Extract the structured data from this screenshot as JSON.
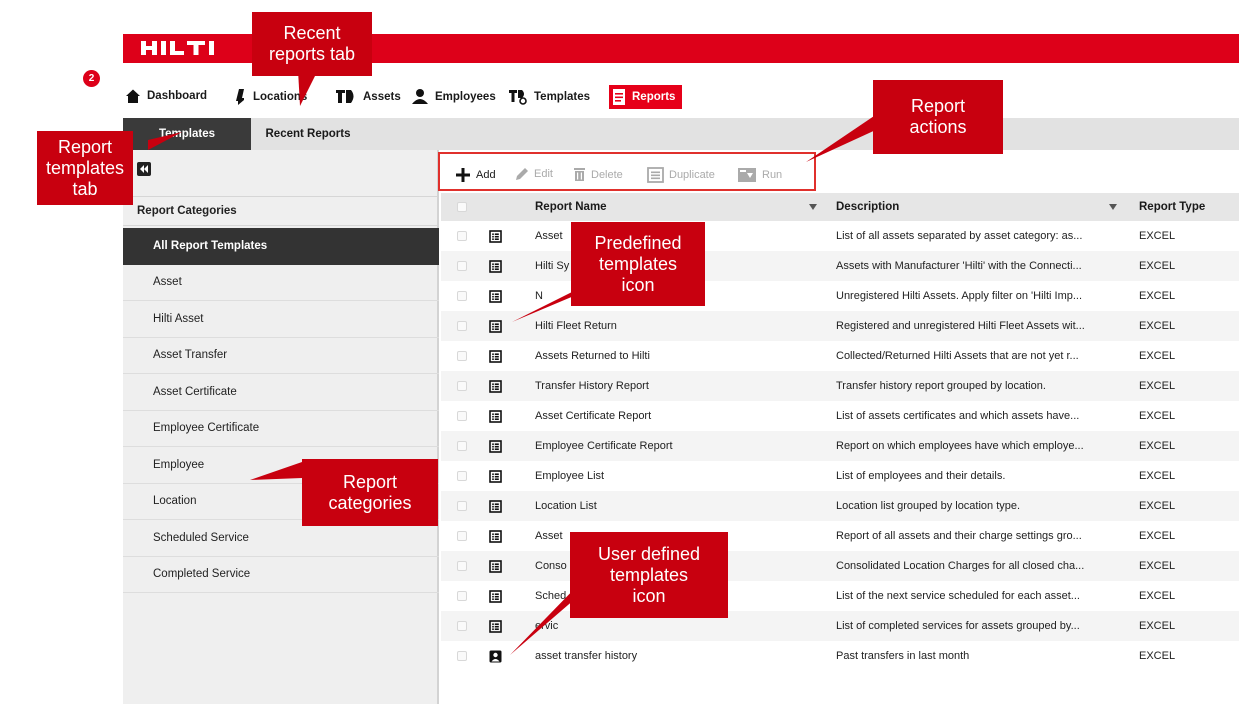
{
  "brand": {
    "logo_text": "HILTI",
    "accent": "#dd0019"
  },
  "nav": {
    "badge": "2",
    "items": [
      {
        "label": "Dashboard",
        "icon": "home-icon"
      },
      {
        "label": "Locations",
        "icon": "location-pin-icon"
      },
      {
        "label": "Assets",
        "icon": "assets-icon"
      },
      {
        "label": "Employees",
        "icon": "employees-icon"
      },
      {
        "label": "Templates",
        "icon": "templates-icon"
      },
      {
        "label": "Reports",
        "icon": "reports-icon"
      }
    ]
  },
  "subtabs": {
    "templates": "Templates",
    "recent": "Recent Reports"
  },
  "toolbar": {
    "add": "Add",
    "edit": "Edit",
    "delete": "Delete",
    "duplicate": "Duplicate",
    "run": "Run"
  },
  "sidebar": {
    "header": "Report Categories",
    "items": [
      "All Report Templates",
      "Asset",
      "Hilti Asset",
      "Asset Transfer",
      "Asset Certificate",
      "Employee Certificate",
      "Employee",
      "Location",
      "Scheduled Service",
      "Completed Service"
    ]
  },
  "table": {
    "headers": {
      "name": "Report Name",
      "description": "Description",
      "type": "Report Type"
    },
    "rows": [
      {
        "name": "Asset",
        "description": "List of all assets separated by asset category: as...",
        "type": "EXCEL",
        "icon": "predefined-template-icon"
      },
      {
        "name": "Hilti Sy",
        "description": "Assets with Manufacturer 'Hilti' with the Connecti...",
        "type": "EXCEL",
        "icon": "predefined-template-icon"
      },
      {
        "name": "N",
        "description": "Unregistered Hilti Assets. Apply filter on 'Hilti Imp...",
        "type": "EXCEL",
        "icon": "predefined-template-icon"
      },
      {
        "name": "Hilti Fleet Return",
        "description": "Registered and unregistered Hilti Fleet Assets wit...",
        "type": "EXCEL",
        "icon": "predefined-template-icon"
      },
      {
        "name": "Assets Returned to Hilti",
        "description": "Collected/Returned Hilti Assets that are not yet r...",
        "type": "EXCEL",
        "icon": "predefined-template-icon"
      },
      {
        "name": "Transfer History Report",
        "description": "Transfer history report grouped by location.",
        "type": "EXCEL",
        "icon": "predefined-template-icon"
      },
      {
        "name": "Asset Certificate Report",
        "description": "List of assets certificates and which assets have...",
        "type": "EXCEL",
        "icon": "predefined-template-icon"
      },
      {
        "name": "Employee Certificate Report",
        "description": "Report on which employees have which employe...",
        "type": "EXCEL",
        "icon": "predefined-template-icon"
      },
      {
        "name": "Employee List",
        "description": "List of employees and their details.",
        "type": "EXCEL",
        "icon": "predefined-template-icon"
      },
      {
        "name": "Location List",
        "description": "Location list grouped by location type.",
        "type": "EXCEL",
        "icon": "predefined-template-icon"
      },
      {
        "name": "Asset",
        "description": "Report of all assets and their charge settings gro...",
        "type": "EXCEL",
        "icon": "predefined-template-icon"
      },
      {
        "name": "Conso",
        "description": "Consolidated Location Charges for all closed cha...",
        "type": "EXCEL",
        "icon": "predefined-template-icon"
      },
      {
        "name": "Sched",
        "description": "List of the next service scheduled for each asset...",
        "type": "EXCEL",
        "icon": "predefined-template-icon"
      },
      {
        "name": "ervic",
        "description": "List of completed services for assets grouped by...",
        "type": "EXCEL",
        "icon": "predefined-template-icon"
      },
      {
        "name": "asset transfer history",
        "description": "Past transfers in last month",
        "type": "EXCEL",
        "icon": "user-defined-template-icon"
      }
    ]
  },
  "callouts": {
    "recent_tab": "Recent\nreports tab",
    "templates_tab": "Report\ntemplates\ntab",
    "actions": "Report\nactions",
    "predefined": "Predefined\ntemplates\nicon",
    "categories": "Report\ncategories",
    "user_defined": "User defined\ntemplates\nicon"
  }
}
